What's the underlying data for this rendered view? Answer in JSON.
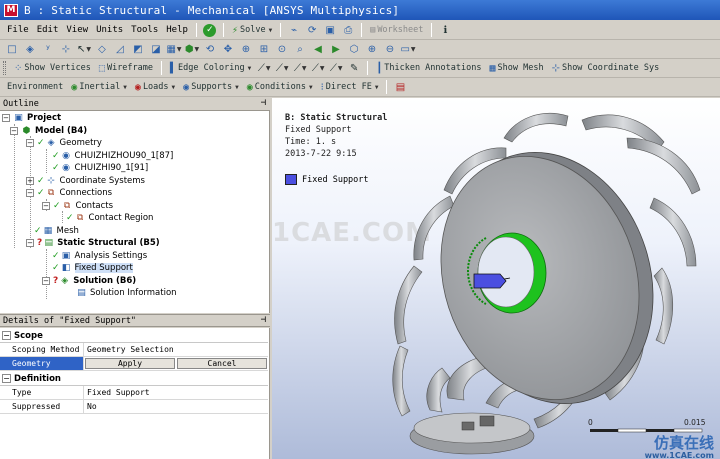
{
  "window": {
    "title": "B : Static Structural - Mechanical [ANSYS Multiphysics]",
    "icon_letter": "M"
  },
  "menu": [
    "File",
    "Edit",
    "View",
    "Units",
    "Tools",
    "Help"
  ],
  "toolbar1": {
    "solve_label": "Solve",
    "worksheet_label": "Worksheet"
  },
  "toolbar3": {
    "show_vertices": "Show Vertices",
    "wireframe": "Wireframe",
    "edge_coloring": "Edge Coloring",
    "thicken_annotations": "Thicken Annotations",
    "show_mesh": "Show Mesh",
    "show_coordinate_systems": "Show Coordinate Sys"
  },
  "toolbar4": {
    "environment": "Environment",
    "inertial": "Inertial",
    "loads": "Loads",
    "supports": "Supports",
    "conditions": "Conditions",
    "direct_fe": "Direct FE"
  },
  "outline": {
    "title": "Outline",
    "items": [
      {
        "label": "Project"
      },
      {
        "label": "Model (B4)"
      },
      {
        "label": "Geometry"
      },
      {
        "label": "CHUIZHIZHOU90_1[87]"
      },
      {
        "label": "CHUIZHI90_1[91]"
      },
      {
        "label": "Coordinate Systems"
      },
      {
        "label": "Connections"
      },
      {
        "label": "Contacts"
      },
      {
        "label": "Contact Region"
      },
      {
        "label": "Mesh"
      },
      {
        "label": "Static Structural (B5)"
      },
      {
        "label": "Analysis Settings"
      },
      {
        "label": "Fixed Support"
      },
      {
        "label": "Solution (B6)"
      },
      {
        "label": "Solution Information"
      }
    ]
  },
  "details": {
    "title": "Details of \"Fixed Support\"",
    "scope_group": "Scope",
    "scoping_method_key": "Scoping Method",
    "scoping_method_val": "Geometry Selection",
    "geometry_key": "Geometry",
    "apply": "Apply",
    "cancel": "Cancel",
    "definition_group": "Definition",
    "type_key": "Type",
    "type_val": "Fixed Support",
    "suppressed_key": "Suppressed",
    "suppressed_val": "No"
  },
  "viewport": {
    "title": "B: Static Structural",
    "subtitle": "Fixed Support",
    "time": "Time: 1. s",
    "date": "2013-7-22 9:15",
    "legend": "Fixed Support",
    "watermark": "1CAE.COM",
    "scale_0": "0",
    "scale_max": "0.015",
    "logo_cn": "仿真在线",
    "logo_url": "www.1CAE.com"
  },
  "colors": {
    "selection": "#2f63c6",
    "fixed_support": "#4b4fe0",
    "green_face": "#22c022",
    "model": "#a9abb0"
  }
}
